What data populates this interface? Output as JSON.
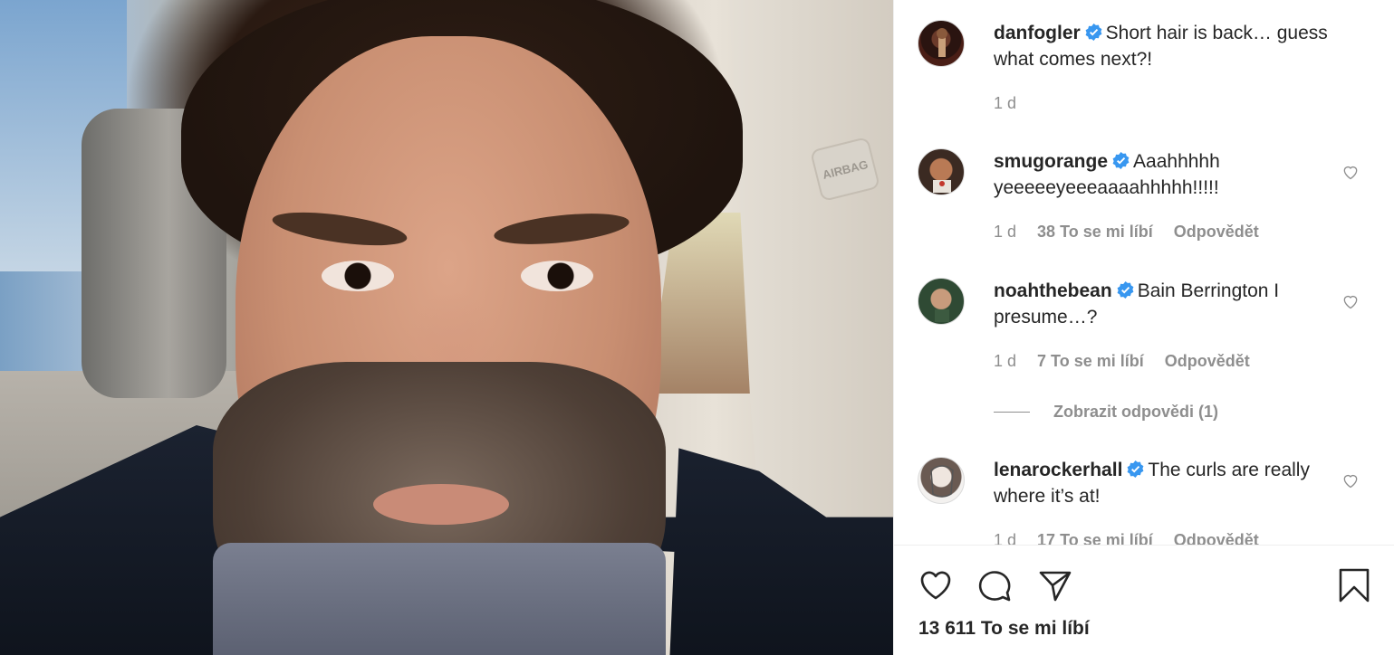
{
  "photo": {
    "airbag_label": "AIRBAG"
  },
  "post": {
    "username": "danfogler",
    "caption": "Short hair is back… guess what comes next?!",
    "time": "1 d"
  },
  "comments": [
    {
      "username": "smugorange",
      "text": "Aaahhhhh yeeeeeyeeeaaaahhhhh!!!!!",
      "time": "1 d",
      "likes": "38 To se mi líbí",
      "reply": "Odpovědět"
    },
    {
      "username": "noahthebean",
      "text": "Bain Berrington I presume…?",
      "time": "1 d",
      "likes": "7 To se mi líbí",
      "reply": "Odpovědět"
    },
    {
      "username": "lenarockerhall",
      "text": "The curls are really where it’s at!",
      "time": "1 d",
      "likes": "17 To se mi líbí",
      "reply": "Odpovědět"
    }
  ],
  "view_replies": "Zobrazit odpovědi (1)",
  "footer": {
    "like_count": "13 611 To se mi líbí"
  },
  "icons": {
    "like": "heart-icon",
    "comment": "comment-bubble-icon",
    "share": "paper-plane-icon",
    "save": "bookmark-icon",
    "verified": "verified-badge-icon",
    "comment_like": "small-heart-icon"
  },
  "colors": {
    "verified_blue": "#3897f0",
    "text": "#262626",
    "secondary": "#8e8e8e"
  }
}
